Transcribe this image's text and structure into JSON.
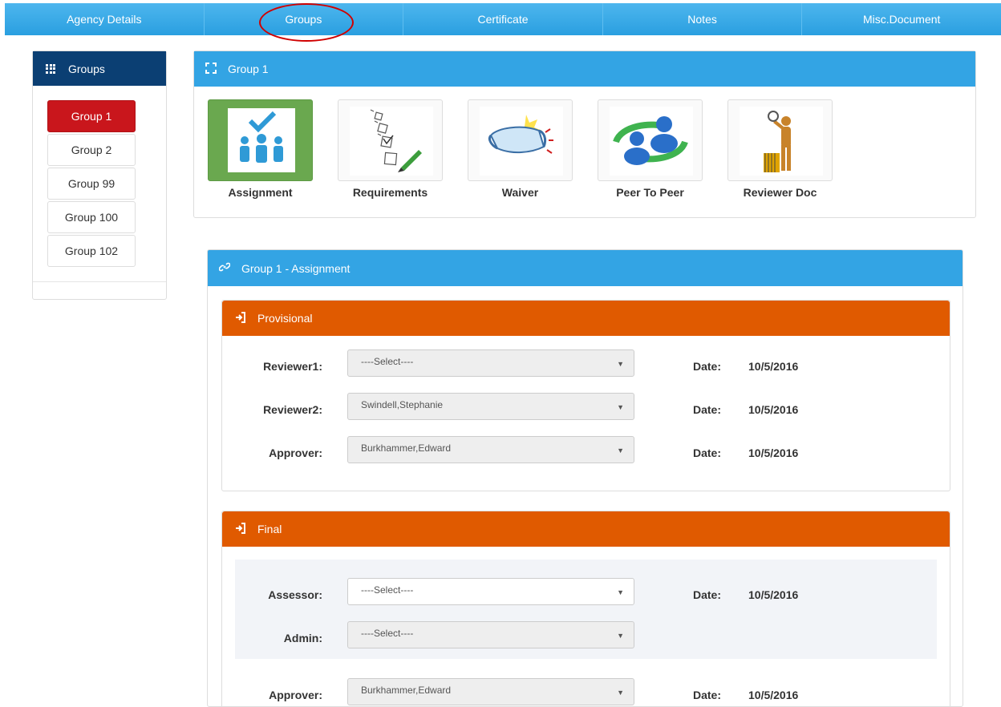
{
  "topnav": {
    "tabs": [
      {
        "label": "Agency Details"
      },
      {
        "label": "Groups"
      },
      {
        "label": "Certificate"
      },
      {
        "label": "Notes"
      },
      {
        "label": "Misc.Document"
      }
    ]
  },
  "sidebar": {
    "title": "Groups",
    "groups": [
      "Group 1",
      "Group 2",
      "Group 99",
      "Group 100",
      "Group 102"
    ],
    "active_group": "Group 1"
  },
  "group_panel": {
    "title": "Group 1",
    "tiles": [
      {
        "label": "Assignment",
        "icon": "assignment-team-check-icon"
      },
      {
        "label": "Requirements",
        "icon": "checklist-icon"
      },
      {
        "label": "Waiver",
        "icon": "waiver-scroll-icon"
      },
      {
        "label": "Peer To Peer",
        "icon": "peer-exchange-icon"
      },
      {
        "label": "Reviewer Doc",
        "icon": "reviewer-magnifier-icon"
      }
    ]
  },
  "assignment": {
    "title": "Group 1 - Assignment",
    "provisional": {
      "title": "Provisional",
      "rows": [
        {
          "label": "Reviewer1:",
          "value": "----Select----",
          "date_label": "Date:",
          "date": "10/5/2016"
        },
        {
          "label": "Reviewer2:",
          "value": "Swindell,Stephanie",
          "date_label": "Date:",
          "date": "10/5/2016"
        },
        {
          "label": "Approver:",
          "value": "Burkhammer,Edward",
          "date_label": "Date:",
          "date": "10/5/2016"
        }
      ]
    },
    "final": {
      "title": "Final",
      "rows": [
        {
          "label": "Assessor:",
          "value": "----Select----",
          "date_label": "Date:",
          "date": "10/5/2016"
        },
        {
          "label": "Admin:",
          "value": "----Select----"
        },
        {
          "label": "Approver:",
          "value": "Burkhammer,Edward",
          "date_label": "Date:",
          "date": "10/5/2016"
        }
      ]
    }
  },
  "colors": {
    "nav_blue": "#2a9fe0",
    "sidebar_head": "#0b3f73",
    "active_red": "#c9161c",
    "orange": "#e05a00",
    "tile_green": "#6aa84f"
  }
}
